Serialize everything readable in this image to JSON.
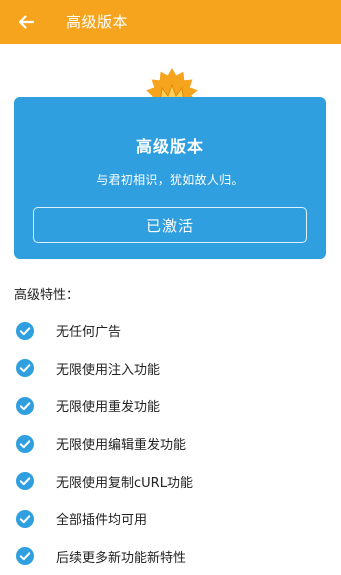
{
  "appbar": {
    "title": "高级版本",
    "back_icon": "arrow-left-icon",
    "color": "#f6a41d"
  },
  "card": {
    "badge_icon": "crown-badge-icon",
    "title": "高级版本",
    "subtitle": "与君初相识，犹如故人归。",
    "button_label": "已激活",
    "color": "#2f9fe0"
  },
  "features": {
    "heading": "高级特性：",
    "check_icon": "check-circle-icon",
    "check_color": "#2f9fe0",
    "items": [
      "无任何广告",
      "无限使用注入功能",
      "无限使用重发功能",
      "无限使用编辑重发功能",
      "无限使用复制cURL功能",
      "全部插件均可用",
      "后续更多新功能新特性"
    ]
  }
}
